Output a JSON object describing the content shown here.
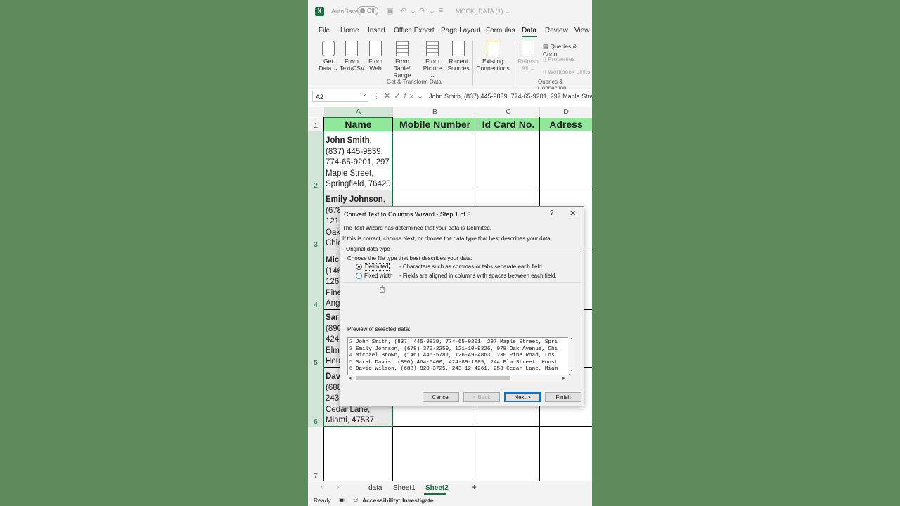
{
  "titlebar": {
    "autosave_label": "AutoSave",
    "autosave_state": "Off",
    "filename": "MOCK_DATA (1)",
    "filename_arrow": "⌄"
  },
  "menu": [
    "File",
    "Home",
    "Insert",
    "Office Expert",
    "Page Layout",
    "Formulas",
    "Data",
    "Review",
    "View"
  ],
  "ribbon": {
    "get_data": [
      "Get",
      "Data ⌄"
    ],
    "from_text_csv": [
      "From",
      "Text/CSV"
    ],
    "from_web": [
      "From",
      "Web"
    ],
    "from_table": [
      "From Table/",
      "Range"
    ],
    "from_picture": [
      "From",
      "Picture ⌄"
    ],
    "recent_sources": [
      "Recent",
      "Sources"
    ],
    "existing_connections": [
      "Existing",
      "Connections"
    ],
    "refresh_all": [
      "Refresh",
      "All ⌄"
    ],
    "queries_connections": "Queries & Conn",
    "properties": "Properties",
    "workbook_links": "Workbook Links",
    "group_get_transform": "Get & Transform Data",
    "group_queries": "Queries & Connection"
  },
  "formula_bar": {
    "name_box": "A2",
    "formula": "John Smith, (837) 445-9839, 774-65-9201, 297 Maple Stre"
  },
  "columns": [
    "A",
    "B",
    "C",
    "D"
  ],
  "rows": [
    "1",
    "2",
    "3",
    "4",
    "5",
    "6",
    "7"
  ],
  "headers": [
    "Name",
    "Mobile Number",
    "Id Card No.",
    "Adress"
  ],
  "cells": {
    "r2": {
      "name": "John Smith",
      "lines": [
        ",",
        "(837) 445-9839,",
        "774-65-9201, 297",
        "Maple Street,",
        "Springfield, 76420"
      ]
    },
    "r3": {
      "name": "Emily Johnson",
      "lines": [
        ",",
        "(678",
        "121",
        "Oak",
        "Chic"
      ]
    },
    "r4": {
      "name": "Mic",
      "lines": [
        "",
        "(146",
        "126",
        "Pine",
        "Ang"
      ]
    },
    "r5": {
      "name": "Sar",
      "lines": [
        "",
        "(890",
        "424",
        "Elm",
        "Hou"
      ]
    },
    "r6": {
      "name": "Dav",
      "lines": [
        "",
        "(688",
        "243",
        "Cedar Lane,",
        "Miami, 47537"
      ]
    }
  },
  "sheets": [
    "data",
    "Sheet1",
    "Sheet2"
  ],
  "add_sheet": "+",
  "status": {
    "ready": "Ready",
    "accessibility": "Accessibility: Investigate"
  },
  "dialog": {
    "title": "Convert Text to Columns Wizard - Step 1 of 3",
    "help": "?",
    "close": "✕",
    "intro1": "The Text Wizard has determined that your data is Delimited.",
    "intro2": "If this is correct, choose Next, or choose the data type that best describes your data.",
    "group_label": "Original data type",
    "choose_label": "Choose the file type that best describes your data:",
    "opt_delimited": "Delimited",
    "opt_delimited_desc": "- Characters such as commas or tabs separate each field.",
    "opt_fixed": "Fixed width",
    "opt_fixed_desc": "- Fields are aligned in columns with spaces between each field.",
    "preview_label": "Preview of selected data:",
    "preview_rows": [
      {
        "num": "2",
        "text": "John Smith, (837) 445-9839, 774-65-9201, 297 Maple Street, Spri"
      },
      {
        "num": "3",
        "text": "Emily Johnson, (678) 370-2259, 121-10-9326, 978 Oak Avenue, Chi"
      },
      {
        "num": "4",
        "text": "Michael Brown, (146) 446-5781, 126-49-4863, 230 Pine Road, Los"
      },
      {
        "num": "5",
        "text": "Sarah Davis, (890) 464-5400, 424-89-1989, 244 Elm Street, Houst"
      },
      {
        "num": "6",
        "text": "David Wilson, (688) 820-3725, 243-12-4261, 253 Cedar Lane, Miam"
      }
    ],
    "btn_cancel": "Cancel",
    "btn_back": "< Back",
    "btn_next": "Next >",
    "btn_finish": "Finish"
  }
}
